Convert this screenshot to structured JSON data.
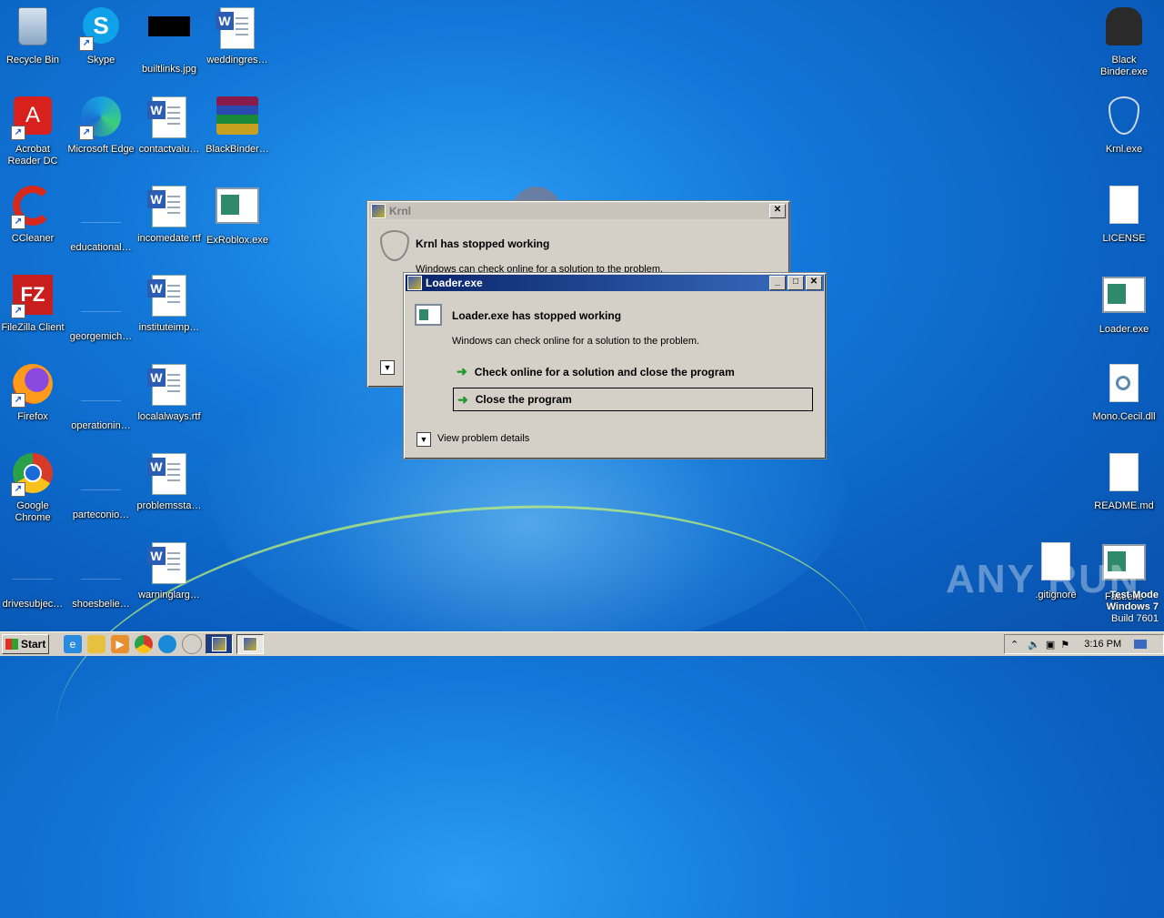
{
  "desktop": {
    "icons_left": [
      {
        "label": "Recycle Bin",
        "icon": "recycle-bin-icon"
      },
      {
        "label": "Skype",
        "icon": "skype-icon"
      },
      {
        "label": "builtlinks.jpg",
        "icon": "image-file-icon"
      },
      {
        "label": "weddingres…",
        "icon": "word-doc-icon"
      },
      {
        "label": "Acrobat Reader DC",
        "icon": "acrobat-icon"
      },
      {
        "label": "Microsoft Edge",
        "icon": "edge-icon"
      },
      {
        "label": "contactvalu…",
        "icon": "word-doc-icon"
      },
      {
        "label": "BlackBinder…",
        "icon": "winrar-icon"
      },
      {
        "label": "CCleaner",
        "icon": "ccleaner-icon"
      },
      {
        "label": "educational…",
        "icon": "file-icon"
      },
      {
        "label": "incomedate.rtf",
        "icon": "word-doc-icon"
      },
      {
        "label": "ExRoblox.exe",
        "icon": "exe-icon"
      },
      {
        "label": "FileZilla Client",
        "icon": "filezilla-icon"
      },
      {
        "label": "georgemich…",
        "icon": "file-icon"
      },
      {
        "label": "instituteimp…",
        "icon": "word-doc-icon"
      },
      {
        "label": "Firefox",
        "icon": "firefox-icon"
      },
      {
        "label": "operationin…",
        "icon": "file-icon"
      },
      {
        "label": "localalways.rtf",
        "icon": "word-doc-icon"
      },
      {
        "label": "Google Chrome",
        "icon": "chrome-icon"
      },
      {
        "label": "parteconio…",
        "icon": "file-icon"
      },
      {
        "label": "problemssta…",
        "icon": "word-doc-icon"
      },
      {
        "label": "drivesubjec…",
        "icon": "file-icon"
      },
      {
        "label": "shoesbelie…",
        "icon": "file-icon"
      },
      {
        "label": "warninglarg…",
        "icon": "word-doc-icon"
      }
    ],
    "icons_right": [
      {
        "label": "Black Binder.exe",
        "icon": "black-cat-icon"
      },
      {
        "label": "Krnl.exe",
        "icon": "krnl-icon"
      },
      {
        "label": "LICENSE",
        "icon": "blank-file-icon"
      },
      {
        "label": "Loader.exe",
        "icon": "exe-icon"
      },
      {
        "label": "Mono.Cecil.dll",
        "icon": "dll-icon"
      },
      {
        "label": "README.md",
        "icon": "blank-file-icon"
      },
      {
        "label": ".gitignore",
        "icon": "blank-file-icon"
      },
      {
        "label": "Fast.exe",
        "icon": "exe-icon"
      }
    ],
    "watermark": "ANY RUN",
    "test_mode": {
      "line1": "Test Mode",
      "line2": "Windows 7",
      "line3": "Build 7601"
    }
  },
  "krnl_dialog": {
    "title": "Krnl",
    "heading": "Krnl has stopped working",
    "sub": "Windows can check online for a solution to the problem.",
    "close": "✕"
  },
  "loader_dialog": {
    "title": "Loader.exe",
    "heading": "Loader.exe has stopped working",
    "sub": "Windows can check online for a solution to the problem.",
    "option1": "Check online for a solution and close the program",
    "option2": "Close the program",
    "details": "View problem details",
    "min": "_",
    "max": "□",
    "close": "✕"
  },
  "taskbar": {
    "start": "Start",
    "clock": "3:16 PM",
    "quicklaunch": [
      "ie-icon",
      "explorer-icon",
      "media-player-icon",
      "chrome-icon",
      "edge-icon",
      "krnl-icon"
    ],
    "tasks": [
      "krnl-task-icon",
      "loader-task-icon"
    ]
  },
  "colors": {
    "accent": "#0a246a",
    "desktop": "#1277d8",
    "dialog_bg": "#d4d0c8"
  }
}
